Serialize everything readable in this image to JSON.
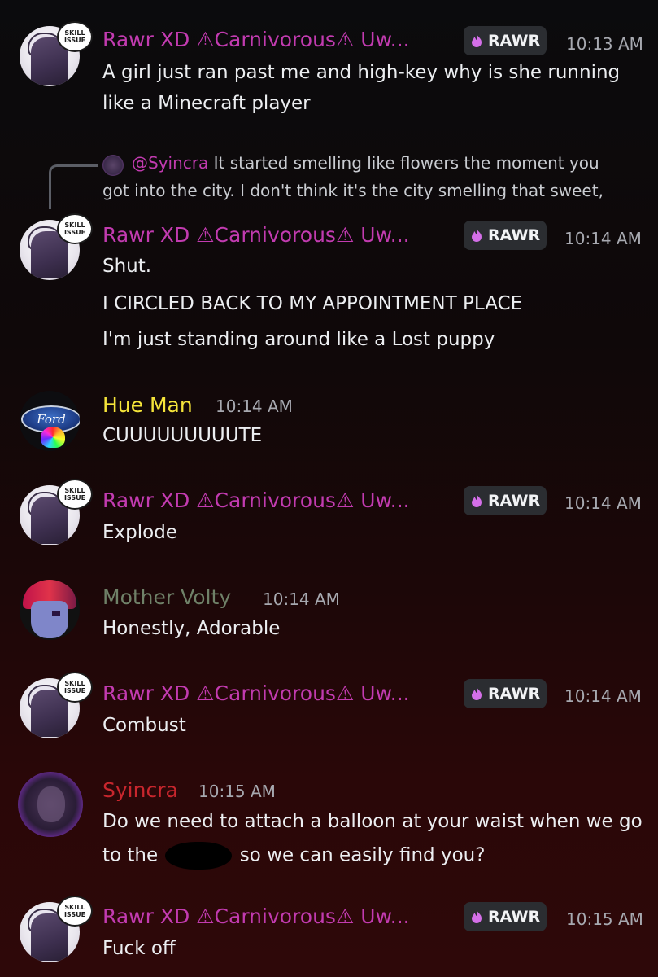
{
  "colors": {
    "rawr": "#c23bb0",
    "hue": "#f5e43a",
    "volty": "#6f8168",
    "syincra": "#c8262d",
    "badge_bg": "#2b2d31",
    "timestamp": "#a7a9b0"
  },
  "avatar_sticker_text": "SKILL ISSUE",
  "hue_logo_text": "Ford",
  "messages": [
    {
      "author": "Rawr XD ⚠Carnivorous⚠ Uw...",
      "badge": "RAWR",
      "badge_icon": "flame-icon",
      "time": "10:13 AM",
      "lines": [
        "A girl just ran past me and high-key why is she running",
        "like a Minecraft player"
      ]
    },
    {
      "reply": {
        "mention": "@Syincra",
        "text_line1": "It started smelling like flowers the moment you",
        "text_line2": "got into the city. I don't think it's the city smelling that sweet,"
      },
      "author": "Rawr XD ⚠Carnivorous⚠ Uw...",
      "badge": "RAWR",
      "badge_icon": "flame-icon",
      "time": "10:14 AM",
      "lines": [
        "Shut.",
        "I CIRCLED BACK TO MY APPOINTMENT PLACE",
        "I'm just standing around like a Lost puppy"
      ]
    },
    {
      "author": "Hue Man",
      "time": "10:14 AM",
      "lines": [
        "CUUUUUUUUUTE"
      ]
    },
    {
      "author": "Rawr XD ⚠Carnivorous⚠ Uw...",
      "badge": "RAWR",
      "badge_icon": "flame-icon",
      "time": "10:14 AM",
      "lines": [
        "Explode"
      ]
    },
    {
      "author": "Mother Volty",
      "time": "10:14 AM",
      "lines": [
        "Honestly, Adorable"
      ]
    },
    {
      "author": "Rawr XD ⚠Carnivorous⚠ Uw...",
      "badge": "RAWR",
      "badge_icon": "flame-icon",
      "time": "10:14 AM",
      "lines": [
        "Combust"
      ]
    },
    {
      "author": "Syincra",
      "time": "10:15 AM",
      "lines": [
        "Do we need to attach a balloon at your waist when we go"
      ],
      "line2_before": "to the",
      "line2_after": "so we can easily find you?"
    },
    {
      "author": "Rawr XD ⚠Carnivorous⚠ Uw...",
      "badge": "RAWR",
      "badge_icon": "flame-icon",
      "time": "10:15 AM",
      "lines": [
        "Fuck off"
      ]
    }
  ]
}
